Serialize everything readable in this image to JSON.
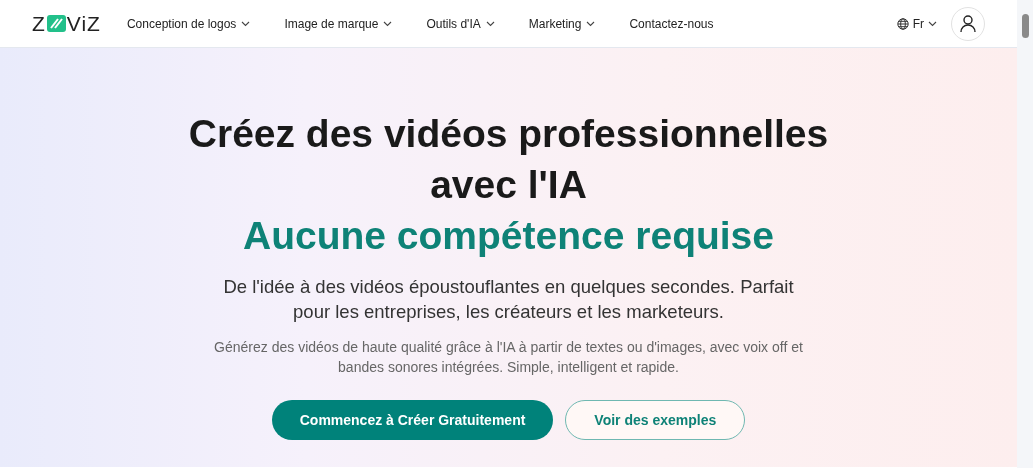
{
  "logo": {
    "before": "Z",
    "after": "ViZ"
  },
  "nav": {
    "items": [
      {
        "label": "Conception de logos",
        "dropdown": true
      },
      {
        "label": "Image de marque",
        "dropdown": true
      },
      {
        "label": "Outils d'IA",
        "dropdown": true
      },
      {
        "label": "Marketing",
        "dropdown": true
      },
      {
        "label": "Contactez-nous",
        "dropdown": false
      }
    ],
    "language": "Fr"
  },
  "hero": {
    "title_lines": [
      "Créez des vidéos professionnelles",
      "avec l'IA"
    ],
    "highlight": "Aucune compétence requise",
    "subtitle": "De l'idée à des vidéos époustouflantes en quelques secondes. Parfait pour les entreprises, les créateurs et les marketeurs.",
    "description": "Générez des vidéos de haute qualité grâce à l'IA à partir de textes ou d'images, avec voix off et bandes sonores intégrées. Simple, intelligent et rapide.",
    "buttons": [
      {
        "label": "Commencez à Créer Gratuitement",
        "kind": "primary"
      },
      {
        "label": "Voir des exemples",
        "kind": "secondary"
      }
    ]
  }
}
